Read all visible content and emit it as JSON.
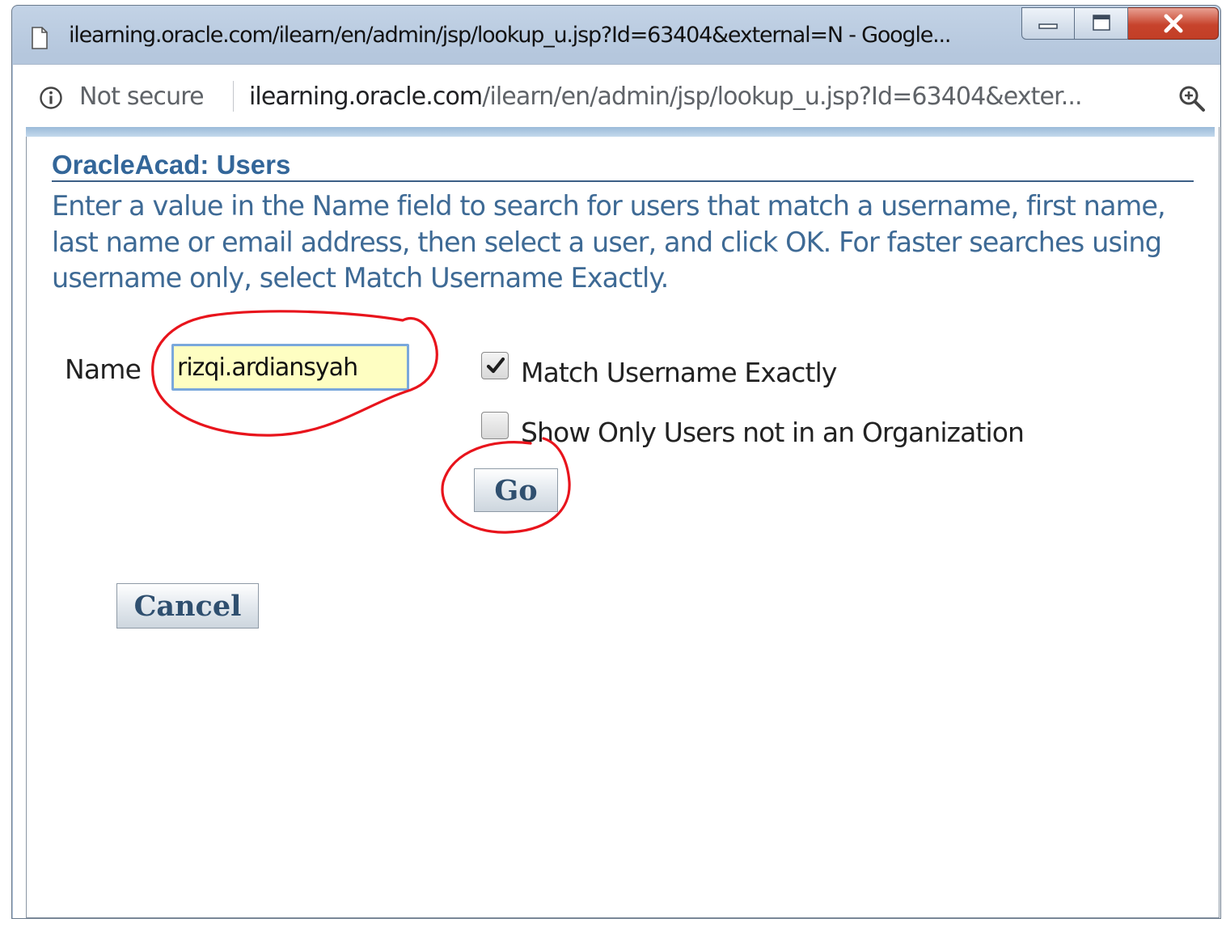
{
  "window": {
    "title": "ilearning.oracle.com/ilearn/en/admin/jsp/lookup_u.jsp?Id=63404&external=N - Google..."
  },
  "address_bar": {
    "security_label": "Not secure",
    "url_host": "ilearning.oracle.com",
    "url_path": "/ilearn/en/admin/jsp/lookup_u.jsp?Id=63404&exter..."
  },
  "page": {
    "title": "OracleAcad: Users",
    "instructions": "Enter a value in the Name field to search for users that match a username, first name, last name or email address, then select a user, and click OK. For faster searches using username only, select Match Username Exactly."
  },
  "form": {
    "name_label": "Name",
    "name_value": "rizqi.ardiansyah",
    "match_username_label": "Match Username Exactly",
    "match_username_checked": true,
    "not_in_org_label": "Show Only Users not in an Organization",
    "not_in_org_checked": false,
    "go_label": "Go",
    "cancel_label": "Cancel"
  },
  "colors": {
    "annotation": "#e8141c",
    "title_text": "#336699",
    "input_background": "#fefec2"
  }
}
